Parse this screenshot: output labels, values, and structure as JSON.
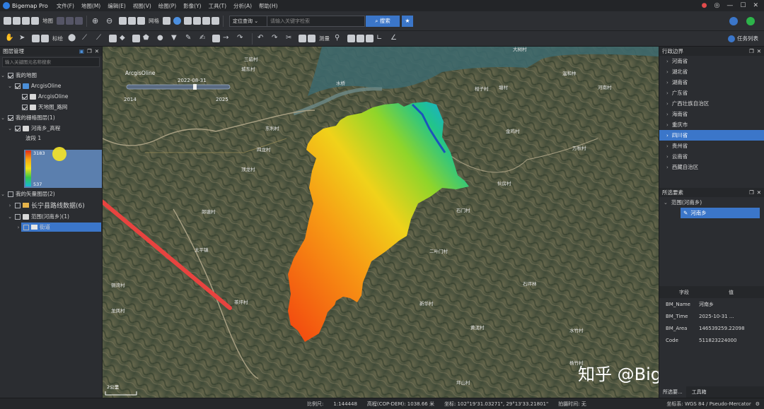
{
  "app": {
    "title": "Bigemap Pro"
  },
  "menu": [
    "文件(F)",
    "地图(M)",
    "编辑(E)",
    "视图(V)",
    "绘图(P)",
    "影像(Y)",
    "工具(T)",
    "分析(A)",
    "帮助(H)"
  ],
  "toolbar1": {
    "map_label": "地图",
    "grid_label": "网格",
    "search_type": "定位查询",
    "search_placeholder": "请输入关键字检索",
    "search_button": "搜索"
  },
  "toolbar2": {
    "mark_label": "标绘",
    "measure_label": "测量",
    "task_list": "任务列表"
  },
  "left_panel": {
    "title": "图层管理",
    "filter_placeholder": "输入关键图元名称搜索",
    "tree": {
      "my_maps": "我的地图",
      "arcgis_group": "ArcgisOline",
      "arcgis_layer": "ArcgisOline",
      "tianditu": "天地图_路网",
      "raster_group": "我的栅格图层(1)",
      "raster_layer": "河南乡_高程",
      "band": "波段 1",
      "legend_max": "3183",
      "legend_min": "537",
      "vector_group": "我的矢量图层(2)",
      "vector_layer1": "长宁县路线数据(6)",
      "vector_layer2": "范围(河南乡)(1)",
      "vector_sub": "街道"
    }
  },
  "map": {
    "overlay_source": "ArcgisOline",
    "timeline_date": "2022-08-31",
    "timeline_start": "2014",
    "timeline_end": "2025",
    "scale_text": "2公里",
    "watermark": "知乎 @Bigemap",
    "place_labels": [
      "三砦村",
      "大树村",
      "城东村",
      "温和林",
      "水桥",
      "塘村",
      "柑子村",
      "河南村",
      "东利村",
      "四龙村",
      "顶龙村",
      "二叶门村",
      "伙房村",
      "石门村",
      "万秋村",
      "太平镇",
      "郎塘村",
      "石坪林",
      "新华村",
      "茶坪村",
      "水竹村",
      "黄泥村",
      "金鸡村",
      "铜湾村",
      "龙凤村",
      "杨竹村",
      "坪山村"
    ]
  },
  "right_panel": {
    "region_title": "行政边界",
    "regions": [
      "河南省",
      "湖北省",
      "湖南省",
      "广东省",
      "广西壮族自治区",
      "海南省",
      "重庆市",
      "四川省",
      "贵州省",
      "云南省",
      "西藏自治区"
    ],
    "selected_region": "四川省",
    "selected_title": "所选要素",
    "selected_group": "范围(河南乡)",
    "selected_item": "河南乡",
    "attr_headers": [
      "字段",
      "值"
    ],
    "attributes": [
      {
        "k": "BM_Name",
        "v": "河南乡"
      },
      {
        "k": "BM_Time",
        "v": "2025-10-31 ..."
      },
      {
        "k": "BM_Area",
        "v": "146539259.22098"
      },
      {
        "k": "Code",
        "v": "511823224000"
      }
    ],
    "tabs": [
      "所选要...",
      "工具箱"
    ]
  },
  "status": {
    "scale_label": "比例尺:",
    "scale_value": "1:144448",
    "elevation": "高程(COP-DEM): 1038.66 米",
    "coords": "坐标: 102°19'31.03271\", 29°13'33.21801\"",
    "shoot_time": "拍摄时间: 无",
    "crs": "坐标系: WGS 84 / Pseudo-Mercator"
  },
  "colors": {
    "accent": "#3b76c9",
    "bg": "#2b2d31"
  }
}
